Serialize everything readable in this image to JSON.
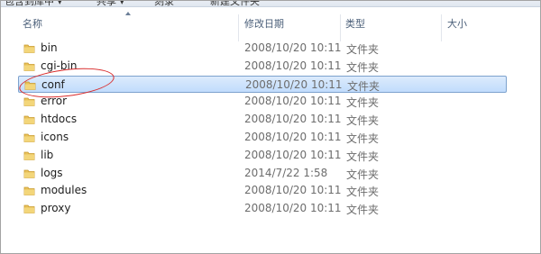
{
  "toolbar": {
    "items": [
      "包含到库中 ▾",
      "共享 ▾",
      "刻录",
      "新建文件夹"
    ]
  },
  "columns": {
    "name": "名称",
    "modified": "修改日期",
    "type": "类型",
    "size": "大小"
  },
  "rows": [
    {
      "name": "bin",
      "modified": "2008/10/20 10:11",
      "type": "文件夹",
      "selected": false
    },
    {
      "name": "cgi-bin",
      "modified": "2008/10/20 10:11",
      "type": "文件夹",
      "selected": false
    },
    {
      "name": "conf",
      "modified": "2008/10/20 10:11",
      "type": "文件夹",
      "selected": true
    },
    {
      "name": "error",
      "modified": "2008/10/20 10:11",
      "type": "文件夹",
      "selected": false
    },
    {
      "name": "htdocs",
      "modified": "2008/10/20 10:11",
      "type": "文件夹",
      "selected": false
    },
    {
      "name": "icons",
      "modified": "2008/10/20 10:11",
      "type": "文件夹",
      "selected": false
    },
    {
      "name": "lib",
      "modified": "2008/10/20 10:11",
      "type": "文件夹",
      "selected": false
    },
    {
      "name": "logs",
      "modified": "2014/7/22 1:58",
      "type": "文件夹",
      "selected": false
    },
    {
      "name": "modules",
      "modified": "2008/10/20 10:11",
      "type": "文件夹",
      "selected": false
    },
    {
      "name": "proxy",
      "modified": "2008/10/20 10:11",
      "type": "文件夹",
      "selected": false
    }
  ],
  "icons": {
    "folder": "folder-icon",
    "sort": "sort-ascending-icon"
  },
  "colors": {
    "selection": "#cce1fb",
    "selection_border": "#7da2ce",
    "annotation": "#d92b2b",
    "folder": "#e8c15a"
  }
}
